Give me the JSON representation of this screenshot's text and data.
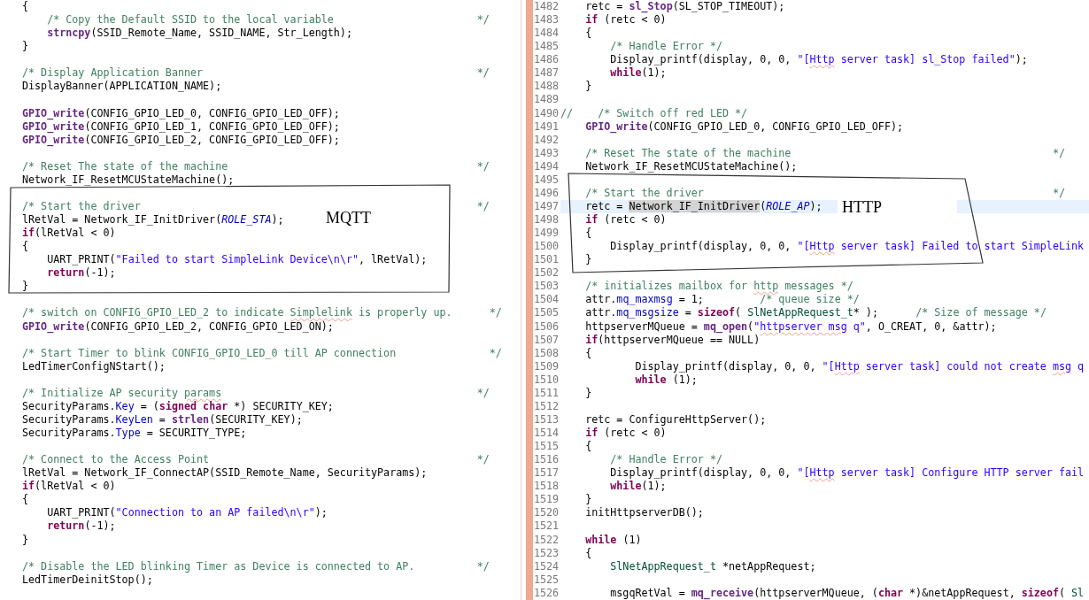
{
  "left": {
    "lines": [
      {
        "kind": "code",
        "code": [
          {
            "text": "{",
            "kind": "plain"
          }
        ]
      },
      {
        "kind": "code",
        "code": [
          {
            "text": "    /* Copy the Default SSID to the local variable                       */",
            "kind": "comment"
          }
        ]
      },
      {
        "kind": "code",
        "code": [
          {
            "text": "    strncpy",
            "kind": "function"
          },
          {
            "text": "(SSID_Remote_Name, SSID_NAME, Str_Length);",
            "kind": "plain"
          }
        ]
      },
      {
        "kind": "code",
        "code": [
          {
            "text": "}",
            "kind": "plain"
          }
        ]
      },
      {
        "kind": "blank"
      },
      {
        "kind": "code",
        "code": [
          {
            "text": "/* Display Application Banner                                            */",
            "kind": "comment"
          }
        ]
      },
      {
        "kind": "code",
        "code": [
          {
            "text": "DisplayBanner(APPLICATION_NAME);",
            "kind": "plain"
          }
        ]
      },
      {
        "kind": "blank"
      },
      {
        "kind": "code",
        "code": [
          {
            "text": "GPIO_write",
            "kind": "function"
          },
          {
            "text": "(CONFIG_GPIO_LED_0, CONFIG_GPIO_LED_OFF);",
            "kind": "plain"
          }
        ]
      },
      {
        "kind": "code",
        "code": [
          {
            "text": "GPIO_write",
            "kind": "function"
          },
          {
            "text": "(CONFIG_GPIO_LED_1, CONFIG_GPIO_LED_OFF);",
            "kind": "plain"
          }
        ]
      },
      {
        "kind": "code",
        "code": [
          {
            "text": "GPIO_write",
            "kind": "function"
          },
          {
            "text": "(CONFIG_GPIO_LED_2, CONFIG_GPIO_LED_OFF);",
            "kind": "plain"
          }
        ]
      },
      {
        "kind": "blank"
      },
      {
        "kind": "code",
        "code": [
          {
            "text": "/* Reset The state of the machine                                        */",
            "kind": "comment"
          }
        ]
      },
      {
        "kind": "code",
        "code": [
          {
            "text": "Network_IF_ResetMCUStateMachine();",
            "kind": "plain"
          }
        ]
      },
      {
        "kind": "blank"
      },
      {
        "kind": "code",
        "code": [
          {
            "text": "/* Start the driver                                                      */",
            "kind": "comment"
          }
        ]
      },
      {
        "kind": "code",
        "code": [
          {
            "text": "lRetVal = Network_IF_InitDriver(",
            "kind": "plain"
          },
          {
            "text": "ROLE_STA",
            "kind": "constant"
          },
          {
            "text": ");",
            "kind": "plain"
          }
        ]
      },
      {
        "kind": "code",
        "code": [
          {
            "text": "if",
            "kind": "keyword"
          },
          {
            "text": "(lRetVal < 0)",
            "kind": "plain"
          }
        ]
      },
      {
        "kind": "code",
        "code": [
          {
            "text": "{",
            "kind": "plain"
          }
        ]
      },
      {
        "kind": "code",
        "code": [
          {
            "text": "    UART_PRINT(",
            "kind": "plain"
          },
          {
            "text": "\"Failed to start SimpleLink Device\\n\\r\"",
            "kind": "string"
          },
          {
            "text": ", lRetVal);",
            "kind": "plain"
          }
        ]
      },
      {
        "kind": "code",
        "code": [
          {
            "text": "    return",
            "kind": "keyword"
          },
          {
            "text": "(-1);",
            "kind": "plain"
          }
        ]
      },
      {
        "kind": "code",
        "code": [
          {
            "text": "}",
            "kind": "plain"
          }
        ]
      },
      {
        "kind": "blank"
      },
      {
        "kind": "code",
        "code": [
          {
            "text": "/* switch on CONFIG_GPIO_LED_2 to indicate ",
            "kind": "comment"
          },
          {
            "text": "Simplelink",
            "kind": "comment-misspelled"
          },
          {
            "text": " is properly up.      */",
            "kind": "comment"
          }
        ]
      },
      {
        "kind": "code",
        "code": [
          {
            "text": "GPIO_write",
            "kind": "function"
          },
          {
            "text": "(CONFIG_GPIO_LED_2, CONFIG_GPIO_LED_ON);",
            "kind": "plain"
          }
        ]
      },
      {
        "kind": "blank"
      },
      {
        "kind": "code",
        "code": [
          {
            "text": "/* Start Timer to blink CONFIG_GPIO_LED_0 till AP connection               */",
            "kind": "comment"
          }
        ]
      },
      {
        "kind": "code",
        "code": [
          {
            "text": "LedTimerConfigNStart();",
            "kind": "plain"
          }
        ]
      },
      {
        "kind": "blank"
      },
      {
        "kind": "code",
        "code": [
          {
            "text": "/* Initialize AP security ",
            "kind": "comment"
          },
          {
            "text": "params",
            "kind": "comment-misspelled"
          },
          {
            "text": "                                         */",
            "kind": "comment"
          }
        ]
      },
      {
        "kind": "code",
        "code": [
          {
            "text": "SecurityParams.",
            "kind": "plain"
          },
          {
            "text": "Key",
            "kind": "field"
          },
          {
            "text": " = (",
            "kind": "plain"
          },
          {
            "text": "signed char",
            "kind": "keyword"
          },
          {
            "text": " *) SECURITY_KEY;",
            "kind": "plain"
          }
        ]
      },
      {
        "kind": "code",
        "code": [
          {
            "text": "SecurityParams.",
            "kind": "plain"
          },
          {
            "text": "KeyLen",
            "kind": "field"
          },
          {
            "text": " = ",
            "kind": "plain"
          },
          {
            "text": "strlen",
            "kind": "function"
          },
          {
            "text": "(SECURITY_KEY);",
            "kind": "plain"
          }
        ]
      },
      {
        "kind": "code",
        "code": [
          {
            "text": "SecurityParams.",
            "kind": "plain"
          },
          {
            "text": "Type",
            "kind": "field"
          },
          {
            "text": " = SECURITY_TYPE;",
            "kind": "plain"
          }
        ]
      },
      {
        "kind": "blank"
      },
      {
        "kind": "code",
        "code": [
          {
            "text": "/* Connect to the Access Point                                           */",
            "kind": "comment"
          }
        ]
      },
      {
        "kind": "code",
        "code": [
          {
            "text": "lRetVal = Network_IF_ConnectAP(SSID_Remote_Name, SecurityParams);",
            "kind": "plain"
          }
        ]
      },
      {
        "kind": "code",
        "code": [
          {
            "text": "if",
            "kind": "keyword"
          },
          {
            "text": "(lRetVal < 0)",
            "kind": "plain"
          }
        ]
      },
      {
        "kind": "code",
        "code": [
          {
            "text": "{",
            "kind": "plain"
          }
        ]
      },
      {
        "kind": "code",
        "code": [
          {
            "text": "    UART_PRINT(",
            "kind": "plain"
          },
          {
            "text": "\"Connection to an AP failed\\n\\r\"",
            "kind": "string"
          },
          {
            "text": ");",
            "kind": "plain"
          }
        ]
      },
      {
        "kind": "code",
        "code": [
          {
            "text": "    return",
            "kind": "keyword"
          },
          {
            "text": "(-1);",
            "kind": "plain"
          }
        ]
      },
      {
        "kind": "code",
        "code": [
          {
            "text": "}",
            "kind": "plain"
          }
        ]
      },
      {
        "kind": "blank"
      },
      {
        "kind": "code",
        "code": [
          {
            "text": "/* Disable the LED blinking Timer as Device is connected to AP.          */",
            "kind": "comment"
          }
        ]
      },
      {
        "kind": "code",
        "code": [
          {
            "text": "LedTimerDeinitStop();",
            "kind": "plain"
          }
        ]
      }
    ],
    "annotation": {
      "label": "MQTT"
    }
  },
  "right": {
    "lines": [
      {
        "number": "1482",
        "current": false,
        "code": [
          {
            "text": "    retc = ",
            "kind": "plain"
          },
          {
            "text": "sl_Stop",
            "kind": "function"
          },
          {
            "text": "(SL_STOP_TIMEOUT);",
            "kind": "plain"
          }
        ]
      },
      {
        "number": "1483",
        "current": false,
        "code": [
          {
            "text": "    if",
            "kind": "keyword"
          },
          {
            "text": " (retc < 0)",
            "kind": "plain"
          }
        ]
      },
      {
        "number": "1484",
        "current": false,
        "code": [
          {
            "text": "    {",
            "kind": "plain"
          }
        ]
      },
      {
        "number": "1485",
        "current": false,
        "code": [
          {
            "text": "        /* Handle Error */",
            "kind": "comment"
          }
        ]
      },
      {
        "number": "1486",
        "current": false,
        "code": [
          {
            "text": "        Display_printf(display, 0, 0, ",
            "kind": "plain"
          },
          {
            "text": "\"[",
            "kind": "string"
          },
          {
            "text": "Http",
            "kind": "string-misspelled"
          },
          {
            "text": " server task] sl_Stop failed\"",
            "kind": "string"
          },
          {
            "text": ");",
            "kind": "plain"
          }
        ]
      },
      {
        "number": "1487",
        "current": false,
        "code": [
          {
            "text": "        while",
            "kind": "keyword"
          },
          {
            "text": "(1);",
            "kind": "plain"
          }
        ]
      },
      {
        "number": "1488",
        "current": false,
        "code": [
          {
            "text": "    }",
            "kind": "plain"
          }
        ]
      },
      {
        "number": "1489",
        "current": false
      },
      {
        "number": "1490",
        "current": false,
        "code": [
          {
            "text": "//    /* Switch off red LED */",
            "kind": "comment"
          }
        ]
      },
      {
        "number": "1491",
        "current": false,
        "code": [
          {
            "text": "    GPIO_write",
            "kind": "function"
          },
          {
            "text": "(CONFIG_GPIO_LED_0, CONFIG_GPIO_LED_OFF);",
            "kind": "plain"
          }
        ]
      },
      {
        "number": "1492",
        "current": false
      },
      {
        "number": "1493",
        "current": false,
        "code": [
          {
            "text": "    /* Reset The state of the machine                                          */",
            "kind": "comment"
          }
        ]
      },
      {
        "number": "1494",
        "current": false,
        "code": [
          {
            "text": "    Network_IF_ResetMCUStateMachine();",
            "kind": "plain"
          }
        ]
      },
      {
        "number": "1495",
        "current": false
      },
      {
        "number": "1496",
        "current": false,
        "code": [
          {
            "text": "    /* Start the driver                                                        */",
            "kind": "comment"
          }
        ]
      },
      {
        "number": "1497",
        "current": true,
        "code": [
          {
            "text": "    retc = ",
            "kind": "plain"
          },
          {
            "text": "Network_IF_InitDriver",
            "kind": "occurrence"
          },
          {
            "text": "(",
            "kind": "plain"
          },
          {
            "text": "ROLE_AP",
            "kind": "constant"
          },
          {
            "text": ");",
            "kind": "plain"
          }
        ]
      },
      {
        "number": "1498",
        "current": false,
        "code": [
          {
            "text": "    if",
            "kind": "keyword"
          },
          {
            "text": " (retc < 0)",
            "kind": "plain"
          }
        ]
      },
      {
        "number": "1499",
        "current": false,
        "code": [
          {
            "text": "    {",
            "kind": "plain"
          }
        ]
      },
      {
        "number": "1500",
        "current": false,
        "code": [
          {
            "text": "        Display_printf(display, 0, 0, ",
            "kind": "plain"
          },
          {
            "text": "\"[",
            "kind": "string"
          },
          {
            "text": "Http",
            "kind": "string-misspelled"
          },
          {
            "text": " server task] Failed to start SimpleLink",
            "kind": "string"
          }
        ]
      },
      {
        "number": "1501",
        "current": false,
        "code": [
          {
            "text": "    }",
            "kind": "plain"
          }
        ]
      },
      {
        "number": "1502",
        "current": false
      },
      {
        "number": "1503",
        "current": false,
        "code": [
          {
            "text": "    /* initializes mailbox for ",
            "kind": "comment"
          },
          {
            "text": "http",
            "kind": "comment-misspelled"
          },
          {
            "text": " messages */",
            "kind": "comment"
          }
        ]
      },
      {
        "number": "1504",
        "current": false,
        "code": [
          {
            "text": "    attr.",
            "kind": "plain"
          },
          {
            "text": "mq_maxmsg",
            "kind": "field"
          },
          {
            "text": " = 1;         ",
            "kind": "plain"
          },
          {
            "text": "/* queue size */",
            "kind": "comment"
          }
        ]
      },
      {
        "number": "1505",
        "current": false,
        "code": [
          {
            "text": "    attr.",
            "kind": "plain"
          },
          {
            "text": "mq_msgsize",
            "kind": "field"
          },
          {
            "text": " = ",
            "kind": "plain"
          },
          {
            "text": "sizeof",
            "kind": "keyword"
          },
          {
            "text": "( ",
            "kind": "plain"
          },
          {
            "text": "SlNetAppRequest_t",
            "kind": "type"
          },
          {
            "text": "* );      ",
            "kind": "plain"
          },
          {
            "text": "/* Size of message */",
            "kind": "comment"
          }
        ]
      },
      {
        "number": "1506",
        "current": false,
        "code": [
          {
            "text": "    httpserverMQueue = ",
            "kind": "plain"
          },
          {
            "text": "mq_open",
            "kind": "function"
          },
          {
            "text": "(",
            "kind": "plain"
          },
          {
            "text": "\"",
            "kind": "string"
          },
          {
            "text": "httpserver",
            "kind": "string-misspelled"
          },
          {
            "text": " msg",
            "kind": "string-misspelled"
          },
          {
            "text": " q\"",
            "kind": "string"
          },
          {
            "text": ", O_CREAT, 0, &attr);",
            "kind": "plain"
          }
        ]
      },
      {
        "number": "1507",
        "current": false,
        "code": [
          {
            "text": "    if",
            "kind": "keyword"
          },
          {
            "text": "(httpserverMQueue == NULL)",
            "kind": "plain"
          }
        ]
      },
      {
        "number": "1508",
        "current": false,
        "code": [
          {
            "text": "    {",
            "kind": "plain"
          }
        ]
      },
      {
        "number": "1509",
        "current": false,
        "code": [
          {
            "text": "            Display_printf(display, 0, 0, ",
            "kind": "plain"
          },
          {
            "text": "\"[",
            "kind": "string"
          },
          {
            "text": "Http",
            "kind": "string-misspelled"
          },
          {
            "text": " server task] could not create ",
            "kind": "string"
          },
          {
            "text": "msg",
            "kind": "string-misspelled"
          },
          {
            "text": " q",
            "kind": "string"
          }
        ]
      },
      {
        "number": "1510",
        "current": false,
        "code": [
          {
            "text": "            while",
            "kind": "keyword"
          },
          {
            "text": " (1);",
            "kind": "plain"
          }
        ]
      },
      {
        "number": "1511",
        "current": false,
        "code": [
          {
            "text": "    }",
            "kind": "plain"
          }
        ]
      },
      {
        "number": "1512",
        "current": false
      },
      {
        "number": "1513",
        "current": false,
        "code": [
          {
            "text": "    retc = ConfigureHttpServer();",
            "kind": "plain"
          }
        ]
      },
      {
        "number": "1514",
        "current": false,
        "code": [
          {
            "text": "    if",
            "kind": "keyword"
          },
          {
            "text": " (retc < 0)",
            "kind": "plain"
          }
        ]
      },
      {
        "number": "1515",
        "current": false,
        "code": [
          {
            "text": "    {",
            "kind": "plain"
          }
        ]
      },
      {
        "number": "1516",
        "current": false,
        "code": [
          {
            "text": "        /* Handle Error */",
            "kind": "comment"
          }
        ]
      },
      {
        "number": "1517",
        "current": false,
        "code": [
          {
            "text": "        Display_printf(display, 0, 0, ",
            "kind": "plain"
          },
          {
            "text": "\"[",
            "kind": "string"
          },
          {
            "text": "Http",
            "kind": "string-misspelled"
          },
          {
            "text": " server task] Configure HTTP server fail",
            "kind": "string"
          }
        ]
      },
      {
        "number": "1518",
        "current": false,
        "code": [
          {
            "text": "        while",
            "kind": "keyword"
          },
          {
            "text": "(1);",
            "kind": "plain"
          }
        ]
      },
      {
        "number": "1519",
        "current": false,
        "code": [
          {
            "text": "    }",
            "kind": "plain"
          }
        ]
      },
      {
        "number": "1520",
        "current": false,
        "code": [
          {
            "text": "    initHttpserverDB();",
            "kind": "plain"
          }
        ]
      },
      {
        "number": "1521",
        "current": false
      },
      {
        "number": "1522",
        "current": false,
        "code": [
          {
            "text": "    while",
            "kind": "keyword"
          },
          {
            "text": " (1)",
            "kind": "plain"
          }
        ]
      },
      {
        "number": "1523",
        "current": false,
        "code": [
          {
            "text": "    {",
            "kind": "plain"
          }
        ]
      },
      {
        "number": "1524",
        "current": false,
        "code": [
          {
            "text": "        SlNetAppRequest_t",
            "kind": "type"
          },
          {
            "text": " *netAppRequest;",
            "kind": "plain"
          }
        ]
      },
      {
        "number": "1525",
        "current": false
      },
      {
        "number": "1526",
        "current": false,
        "code": [
          {
            "text": "        msgqRetVal = ",
            "kind": "plain"
          },
          {
            "text": "mq_receive",
            "kind": "function"
          },
          {
            "text": "(httpserverMQueue, (",
            "kind": "plain"
          },
          {
            "text": "char",
            "kind": "keyword"
          },
          {
            "text": " *)&netAppRequest, ",
            "kind": "plain"
          },
          {
            "text": "sizeof",
            "kind": "keyword"
          },
          {
            "text": "( ",
            "kind": "plain"
          },
          {
            "text": "Sl",
            "kind": "type"
          }
        ]
      }
    ],
    "annotation": {
      "label": "HTTP"
    }
  }
}
